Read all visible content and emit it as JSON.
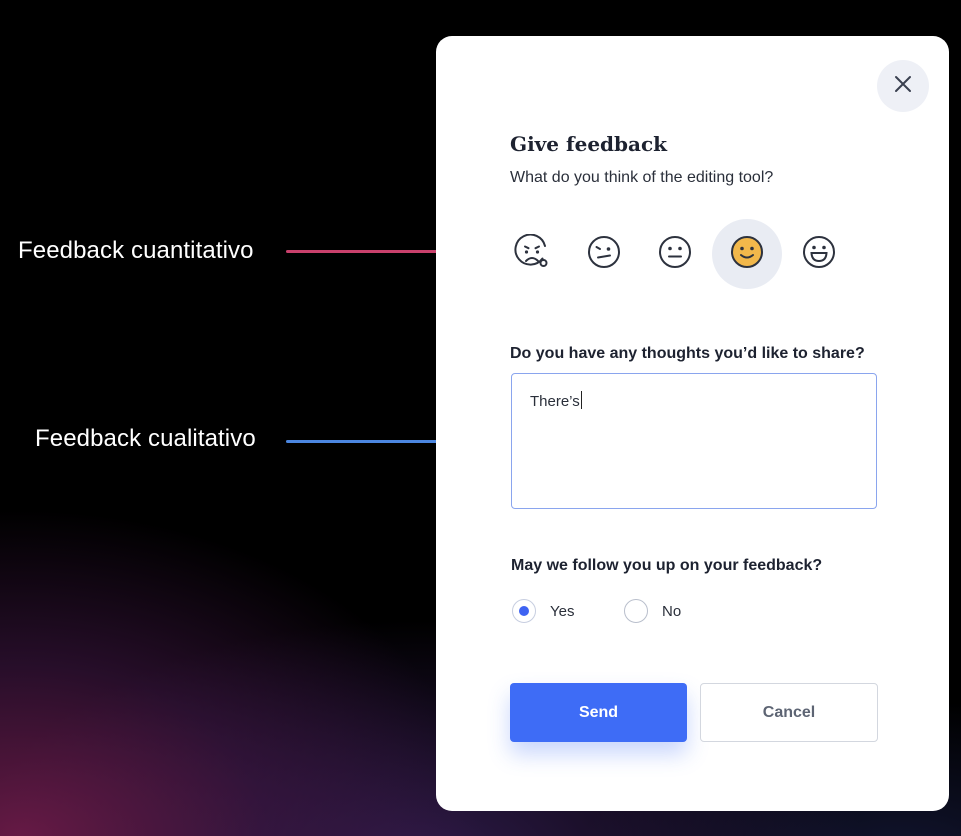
{
  "annotations": {
    "quantitative": {
      "label": "Feedback cuantitativo",
      "color": "#c9406c"
    },
    "qualitative": {
      "label": "Feedback cualitativo",
      "color": "#4b86e0"
    }
  },
  "dialog": {
    "title": "Give feedback",
    "subtitle": "What do you think of the editing tool?",
    "rating": {
      "options": [
        {
          "icon": "very-unhappy-face-icon"
        },
        {
          "icon": "unhappy-face-icon"
        },
        {
          "icon": "neutral-face-icon"
        },
        {
          "icon": "happy-face-icon"
        },
        {
          "icon": "very-happy-face-icon"
        }
      ],
      "selected_index": 3,
      "selected_color": "#f2b84b"
    },
    "thoughts": {
      "question": "Do you have any thoughts you’d like to share?",
      "value": "There’s"
    },
    "follow_up": {
      "question": "May we follow you up on your feedback?",
      "options": [
        {
          "label": "Yes",
          "checked": true
        },
        {
          "label": "No",
          "checked": false
        }
      ]
    },
    "buttons": {
      "send": "Send",
      "cancel": "Cancel"
    },
    "accent_color": "#3e6cf6"
  }
}
